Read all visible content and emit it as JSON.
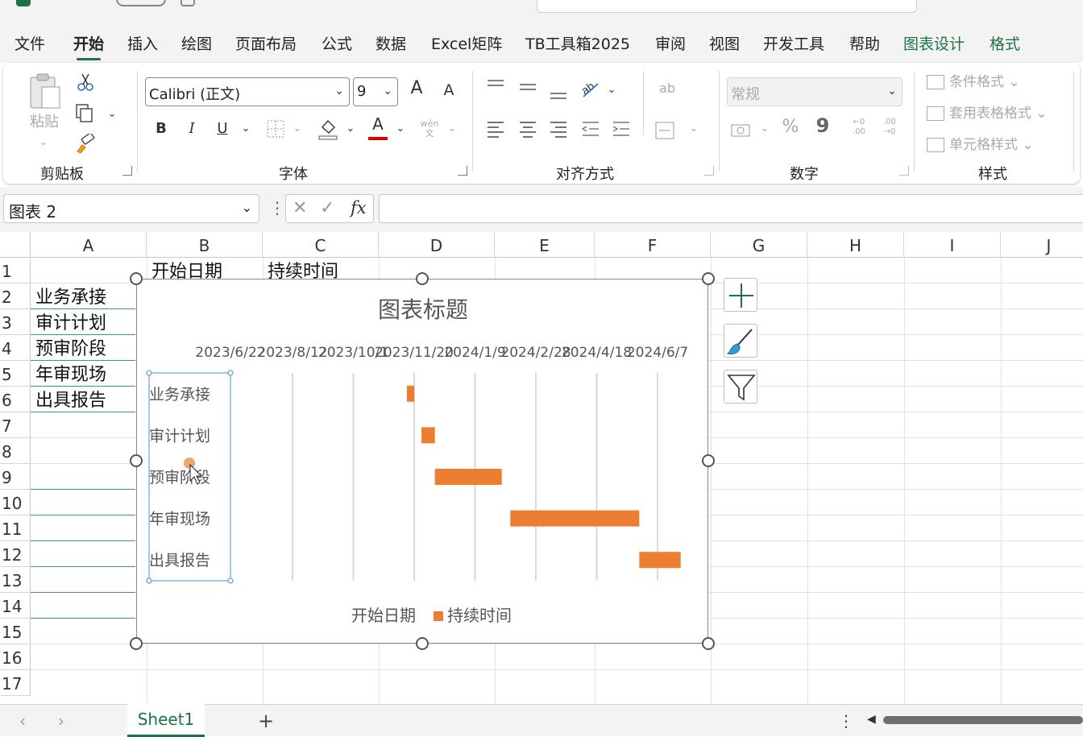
{
  "menu": {
    "items": [
      "文件",
      "开始",
      "插入",
      "绘图",
      "页面布局",
      "公式",
      "数据",
      "Excel矩阵",
      "TB工具箱2025",
      "审阅",
      "视图",
      "开发工具",
      "帮助",
      "图表设计",
      "格式"
    ],
    "active": "开始"
  },
  "ribbon": {
    "clipboard": {
      "paste_label": "粘贴",
      "group_label": "剪贴板"
    },
    "font": {
      "font_name": "Calibri (正文)",
      "font_size": "9",
      "grow_label": "A",
      "shrink_label": "A",
      "bold": "B",
      "italic": "I",
      "underline": "U",
      "font_color_label": "A",
      "phonetic_label": "wén",
      "phonetic_sub": "文",
      "group_label": "字体"
    },
    "alignment": {
      "group_label": "对齐方式",
      "wrap_label": "ab"
    },
    "number": {
      "format_value": "常规",
      "percent": "%",
      "comma": "9",
      "inc_decimal": "←0 .00",
      "dec_decimal": ".00 →0",
      "group_label": "数字"
    },
    "styles": {
      "conditional": "条件格式",
      "table_format": "套用表格格式",
      "cell_styles": "单元格样式",
      "group_label": "样式"
    },
    "colors": {
      "accent": "#1e7145",
      "font_color_bar": "#e00000"
    }
  },
  "formula_bar": {
    "name_box": "图表 2",
    "fx_label": "fx",
    "formula": ""
  },
  "columns": [
    "A",
    "B",
    "C",
    "D",
    "E",
    "F",
    "G",
    "H",
    "I",
    "J"
  ],
  "rows": [
    "1",
    "2",
    "3",
    "4",
    "5",
    "6",
    "7",
    "8",
    "9",
    "10",
    "11",
    "12",
    "13",
    "14",
    "15",
    "16",
    "17"
  ],
  "cells": {
    "B1": "开始日期",
    "C1": "持续时间",
    "A2": "业务承接",
    "A3": "审计计划",
    "A4": "预审阶段",
    "A5": "年审现场",
    "A6": "出具报告"
  },
  "chart_data": {
    "type": "bar",
    "orientation": "horizontal",
    "stacked": true,
    "title": "图表标题",
    "categories": [
      "业务承接",
      "审计计划",
      "预审阶段",
      "年审现场",
      "出具报告"
    ],
    "x_tick_labels": [
      "2023/6/22",
      "2023/8/12",
      "2023/10/1",
      "2023/11/20",
      "2024/1/9",
      "2024/2/28",
      "2024/4/18",
      "2024/6/7"
    ],
    "x_axis_position": "top",
    "xlim": [
      "2023/6/22",
      "2024/7/27"
    ],
    "series": [
      {
        "name": "开始日期",
        "start": [
          "2023/11/14",
          "2023/11/26",
          "2023/12/7",
          "2024/2/7",
          "2024/5/23"
        ],
        "color": "none"
      },
      {
        "name": "持续时间",
        "values": [
          6,
          11,
          55,
          106,
          34
        ],
        "color": "#ed7d31"
      }
    ],
    "legend_position": "bottom",
    "grid": "vertical"
  },
  "sheet_tabs": {
    "active": "Sheet1",
    "add_label": "+"
  }
}
